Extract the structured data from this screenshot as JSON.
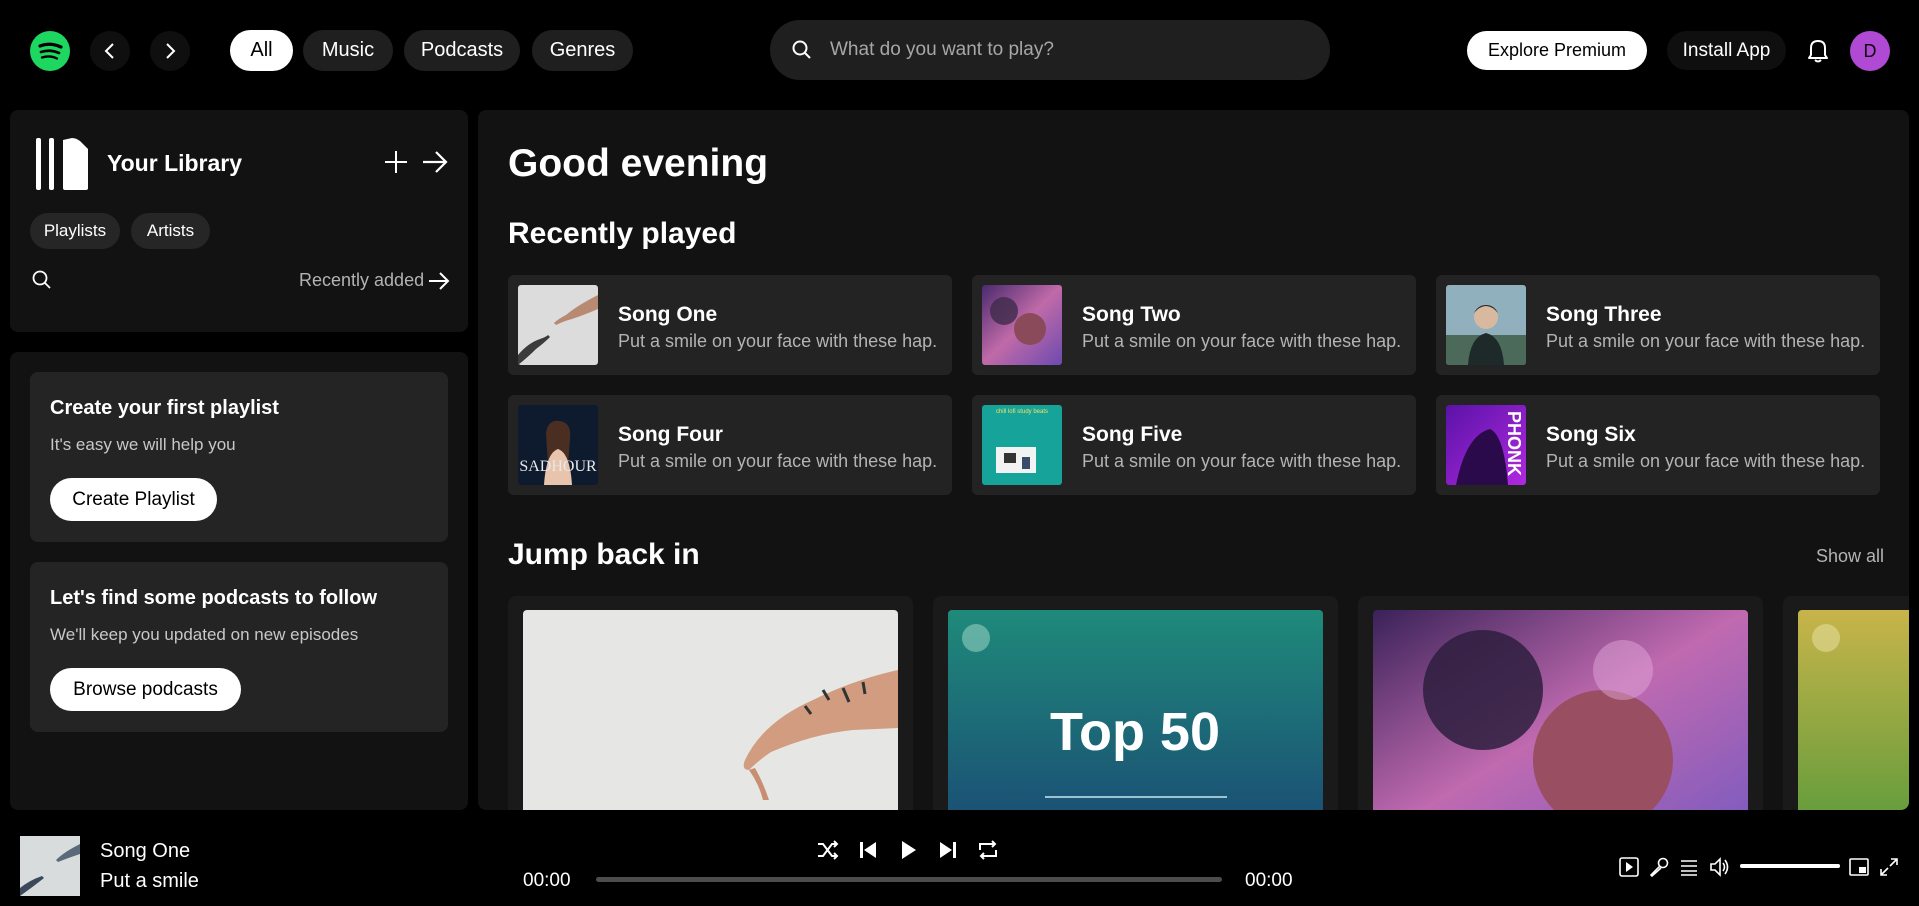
{
  "header": {
    "tabs": [
      {
        "label": "All",
        "active": true
      },
      {
        "label": "Music",
        "active": false
      },
      {
        "label": "Podcasts",
        "active": false
      },
      {
        "label": "Genres",
        "active": false
      }
    ],
    "search_placeholder": "What do you want to play?",
    "explore_premium": "Explore Premium",
    "install_app": "Install App",
    "avatar_initial": "D",
    "icons": [
      "spotify-logo",
      "back-icon",
      "forward-icon",
      "search-icon",
      "bell-icon"
    ]
  },
  "library": {
    "title": "Your Library",
    "filters": [
      "Playlists",
      "Artists"
    ],
    "sort_label": "Recently added",
    "icons": [
      "library-icon",
      "plus-icon",
      "arrow-right-icon",
      "search-icon"
    ]
  },
  "sidebar_cards": [
    {
      "title": "Create your first playlist",
      "subtitle": "It's easy we will help you",
      "button": "Create Playlist"
    },
    {
      "title": "Let's find some podcasts to follow",
      "subtitle": "We'll keep you updated on new episodes",
      "button": "Browse podcasts"
    }
  ],
  "main": {
    "greeting": "Good evening",
    "recently_played_title": "Recently played",
    "recently_played": [
      {
        "title": "Song One",
        "desc": "Put a smile on your face with these hap..."
      },
      {
        "title": "Song Two",
        "desc": "Put a smile on your face with these hap..."
      },
      {
        "title": "Song Three",
        "desc": "Put a smile on your face with these hap..."
      },
      {
        "title": "Song Four",
        "desc": "Put a smile on your face with these hap..."
      },
      {
        "title": "Song Five",
        "desc": "Put a smile on your face with these hap..."
      },
      {
        "title": "Song Six",
        "desc": "Put a smile on your face with these hap..."
      }
    ],
    "thumb_texts": {
      "song_four": "SADHOUR",
      "song_five": "chill lofi study beats",
      "song_six": "PHONK"
    },
    "jump_back_title": "Jump back in",
    "show_all": "Show all",
    "jump_back": [
      {
        "art": "hand"
      },
      {
        "art": "top50",
        "text": "Top 50"
      },
      {
        "art": "portrait"
      },
      {
        "art": "yellow-green"
      }
    ]
  },
  "player": {
    "title": "Song One",
    "artist": "Put a smile",
    "time_current": "00:00",
    "time_total": "00:00",
    "progress": 0,
    "volume": 1.0,
    "icons": [
      "shuffle-icon",
      "previous-icon",
      "play-icon",
      "next-icon",
      "repeat-icon",
      "now-playing-view-icon",
      "lyrics-icon",
      "queue-icon",
      "volume-icon",
      "mini-player-icon",
      "fullscreen-icon"
    ]
  },
  "colors": {
    "accent": "#1ed760",
    "avatar": "#b04ad5",
    "background": "#000000",
    "panel": "#121212"
  }
}
